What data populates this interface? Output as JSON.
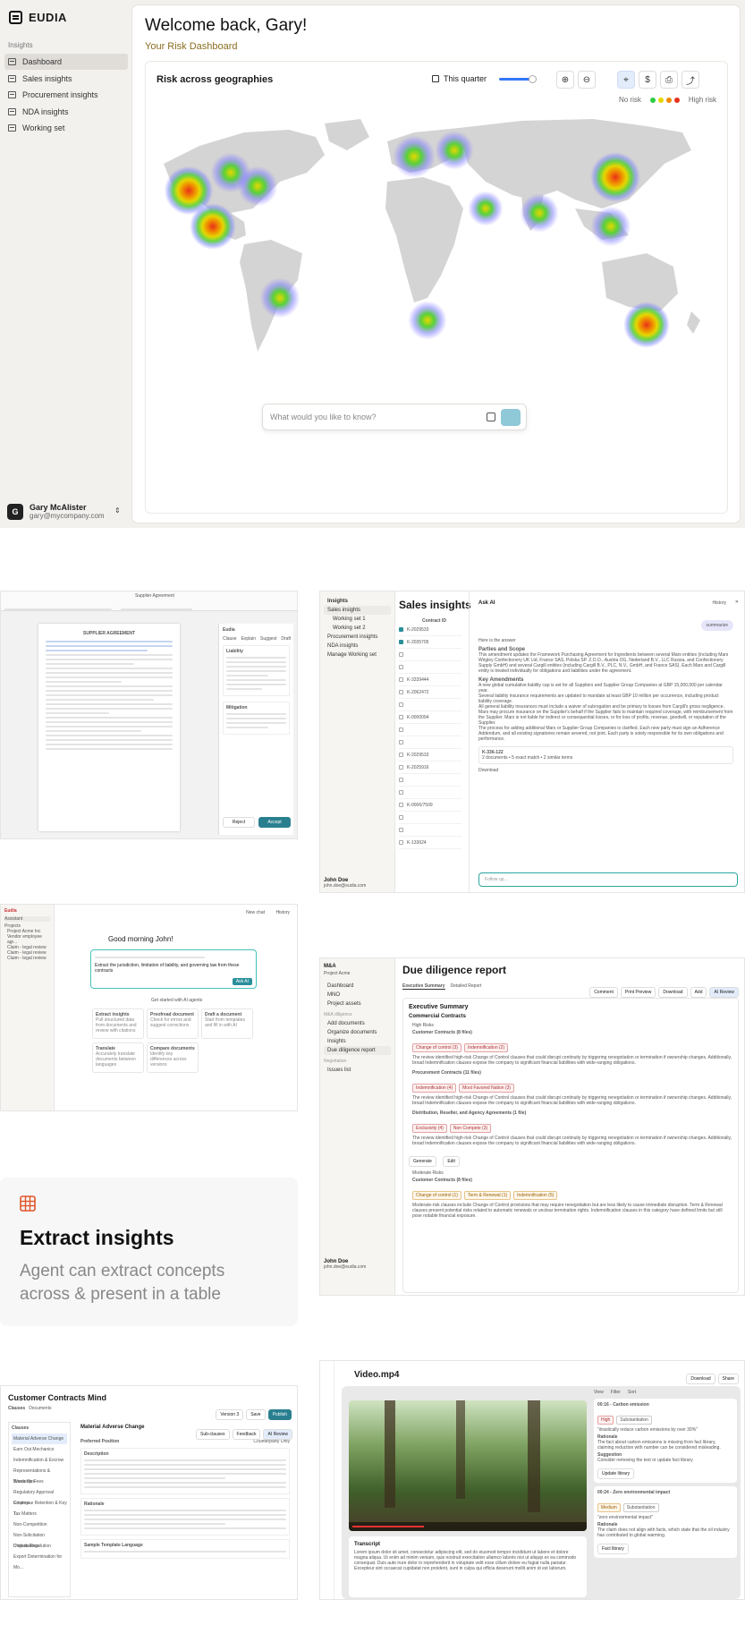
{
  "app": {
    "brand": "EUDIA"
  },
  "sidebar": {
    "section": "Insights",
    "items": [
      {
        "label": "Dashboard",
        "active": true
      },
      {
        "label": "Sales insights"
      },
      {
        "label": "Procurement insights"
      },
      {
        "label": "NDA insights"
      },
      {
        "label": "Working set"
      }
    ],
    "user": {
      "initial": "G",
      "name": "Gary McAlister",
      "email": "gary@mycompany.com"
    }
  },
  "dashboard": {
    "welcome": "Welcome back, Gary!",
    "subtitle": "Your Risk Dashboard",
    "map_title": "Risk across geographies",
    "period": "This quarter",
    "period_slider_level": 1.0,
    "legend": {
      "low": "No risk",
      "high": "High risk",
      "colors": [
        "#2ecc40",
        "#e5d700",
        "#f08a00",
        "#e8321b"
      ]
    },
    "ask_placeholder": "What would you like to know?",
    "hotspots": [
      {
        "region": "western-usa",
        "level": 0.95
      },
      {
        "region": "central-usa",
        "level": 0.6
      },
      {
        "region": "eastern-usa",
        "level": 0.6
      },
      {
        "region": "mexico",
        "level": 0.85
      },
      {
        "region": "brazil",
        "level": 0.6
      },
      {
        "region": "western-europe",
        "level": 0.7
      },
      {
        "region": "eastern-europe",
        "level": 0.55
      },
      {
        "region": "middle-east",
        "level": 0.4
      },
      {
        "region": "southern-africa",
        "level": 0.55
      },
      {
        "region": "india",
        "level": 0.55
      },
      {
        "region": "china",
        "level": 1.0
      },
      {
        "region": "southeast-asia",
        "level": 0.6
      },
      {
        "region": "australia",
        "level": 0.85
      }
    ]
  },
  "word_addin": {
    "title": "Supplier Agreement",
    "doc_heading": "SUPPLIER AGREEMENT",
    "pane_title": "Eudia",
    "pane_tabs": [
      "Clause",
      "Explain",
      "Suggest",
      "Draft"
    ],
    "liability": "Liability",
    "mitigation": "Mitigation",
    "buttons": [
      "Reject",
      "Accept"
    ]
  },
  "sales": {
    "title": "Sales insights",
    "ask_ai": "Ask AI",
    "history": "History",
    "summarize": "summarize",
    "intro": "Here is the answer",
    "parties_heading": "Parties and Scope",
    "parties_text": "This amendment updates the Framework Purchasing Agreement for Ingredients between several Mars entities (including Mars Wrigley Confectionery UK Ltd, France SAS, Polska SP. Z.O.O., Austria OG, Nederland B.V., LLC Russia, and Confectionery Supply GmbH) and several Cargill entities (including Cargill B.V., PLC, N.V., GmbH, and France SAS). Each Mars and Cargill entity is treated individually for obligations and liabilities under the agreement.",
    "amend_heading": "Key Amendments",
    "amendments": [
      "A new global cumulative liability cap is set for all Suppliers and Supplier Group Companies at GBP 15,000,000 per calendar year.",
      "Several liability insurance requirements are updated to mandate at least GBP 10 million per occurrence, including product liability coverage.",
      "All general liability insurances must include a waiver of subrogation and be primary to losses from Cargill's gross negligence. Mars may procure insurance on the Supplier's behalf if the Supplier fails to maintain required coverage, with reimbursement from the Supplier. Mars is not liable for indirect or consequential losses, or for loss of profits, revenue, goodwill, or reputation of the Supplier.",
      "The process for adding additional Mars or Supplier Group Companies is clarified. Each new party must sign an Adherence Addendum, and all existing signatories remain severed, not joint. Each party is solely responsible for its own obligations and performance."
    ],
    "ref": "K-336-122",
    "ref_sub": "2 documents • 5 exact match • 2 similar terms",
    "download": "Download",
    "follow_up": "Follow up...",
    "contract_header": "Contract ID",
    "contracts": [
      "K-2029533",
      "K-2035705",
      "",
      "",
      "K-3339444",
      "K-2062472",
      "",
      "K-0000094",
      "",
      "",
      "K-2029533",
      "K-2025916",
      "",
      "",
      "K-0006/7509",
      "",
      "",
      "K-133624"
    ],
    "side_items": [
      "Insights",
      "Sales insights",
      "Working set 1",
      "Working set 2",
      "Procurement insights",
      "NDA insights",
      "Manage Working set"
    ],
    "user": {
      "name": "John Doe",
      "email": "john.doe@eudia.com"
    }
  },
  "home": {
    "greeting": "Good morning John!",
    "new_chat": "New chat",
    "history": "History",
    "prompt": "Extract the jurisdiction, limitation of liability, and governing law from these contracts",
    "ask": "Ask AI",
    "get_started": "Get started with AI agents",
    "cards": [
      {
        "title": "Extract insights",
        "text": "Pull structured data from documents and review with citations"
      },
      {
        "title": "Proofread document",
        "text": "Check for errors and suggest corrections"
      },
      {
        "title": "Draft a document",
        "text": "Start from templates and fill in with AI"
      },
      {
        "title": "Translate",
        "text": "Accurately translate documents between languages"
      },
      {
        "title": "Compare documents",
        "text": "Identify key differences across versions"
      }
    ],
    "side_items": [
      "Eudia",
      "Assistant",
      "Projects",
      "Project Acme Inc",
      "Vendor employee agr...",
      "Claim - legal review",
      "Claim - legal review",
      "Claim - legal review"
    ]
  },
  "dd": {
    "side_title": "M&A",
    "project": "Project Acme",
    "side_items": [
      "Dashboard",
      "MNO",
      "Project assets",
      "Add documents",
      "Organize documents",
      "Insights",
      "Due diligence report",
      "Issues list"
    ],
    "side_sections": [
      "M&A diligence",
      "Negotiation"
    ],
    "title": "Due diligence report",
    "tabs": [
      "Executive Summary",
      "Detailed Report"
    ],
    "actions": [
      "Comment",
      "Print Preview",
      "Download",
      "Add",
      "AI Review"
    ],
    "exec_summary": "Executive Summary",
    "commercial": "Commercial Contracts",
    "high_risks": "High Risks",
    "blocks": [
      {
        "title": "Customer Contracts (8 files)",
        "tags": [
          "Change of control (3)",
          "Indemnification (2)"
        ],
        "text": "The review identified high-risk Change of Control clauses that could disrupt continuity by triggering renegotiation or termination if ownership changes. Additionally, broad Indemnification clauses expose the company to significant financial liabilities with wide-ranging obligations."
      },
      {
        "title": "Procurement Contracts (11 files)",
        "tags": [
          "Indemnification (4)",
          "Most Favored Nation (3)"
        ],
        "text": "The review identified high-risk Change of Control clauses that could disrupt continuity by triggering renegotiation or termination if ownership changes. Additionally, broad Indemnification clauses expose the company to significant financial liabilities with wide-ranging obligations."
      },
      {
        "title": "Distribution, Reseller, and Agency Agreements (1 file)",
        "tags": [
          "Exclusivity (4)",
          "Non Compete (3)"
        ],
        "text": "The review identified high-risk Change of Control clauses that could disrupt continuity by triggering renegotiation or termination if ownership changes. Additionally, broad Indemnification clauses expose the company to significant financial liabilities with wide-ranging obligations."
      }
    ],
    "generate": "Generate",
    "edit": "Edit",
    "moderate": "Moderate Risks",
    "mod_block": {
      "title": "Customer Contracts (8 files)",
      "tags": [
        "Change of control (1)",
        "Term & Renewal (1)",
        "Indemnification (5)"
      ],
      "text": "Moderate-risk clauses include Change of Control provisions that may require renegotiation but are less likely to cause immediate disruption. Term & Renewal clauses present potential risks related to automatic renewals or unclear termination rights. Indemnification clauses in this category have defined limits but still pose notable financial exposure."
    },
    "user": {
      "name": "John Doe",
      "email": "john.doe@eudia.com"
    }
  },
  "feature": {
    "title": "Extract insights",
    "text": "Agent can extract concepts across & present in a table"
  },
  "playbook": {
    "title": "Customer Contracts Mind",
    "tabs": [
      "Clauses",
      "Documents"
    ],
    "version": "Version 3",
    "save": "Save",
    "publish": "Publish",
    "clauses_heading": "Clauses",
    "clauses": [
      "Material Adverse Change",
      "Earn Out Mechanics",
      "Indemnification & Escrow",
      "Representations & Warranties",
      "Break-Up Fees",
      "Regulatory Approval Covena...",
      "Employee Retention & Key T...",
      "Tax Matters",
      "Non-Competition",
      "Non-Solicitation Undertakings",
      "Dispute Resolution",
      "Export Determination for Mo..."
    ],
    "clause_title": "Material Adverse Change",
    "clause_actions": [
      "Sub-clauses",
      "Feedback",
      "AI Review"
    ],
    "preferred": "Preferred Position",
    "party": "Counterparty Only",
    "sections": [
      "Description",
      "Rationale",
      "Sample Template Language"
    ]
  },
  "video": {
    "title": "Video.mp4",
    "actions": [
      "Download",
      "Share"
    ],
    "view": "View",
    "filter": "Filter",
    "sort": "Sort",
    "transcript": "Transcript",
    "transcript_text": "Lorem ipsum dolor sit amet, consectetur adipiscing elit, sed do eiusmod tempor incididunt ut labore et dolore magna aliqua. Ut enim ad minim veniam, quis nostrud exercitation ullamco laboris nisi ut aliquip ex ea commodo consequat. Duis aute irure dolor in reprehenderit in voluptate velit esse cillum dolore eu fugiat nulla pariatur. Excepteur sint occaecat cupidatat non proident, sunt in culpa qui officia deserunt mollit anim id est laborum.",
    "items": [
      {
        "time": "00:16 - Carbon emission",
        "badges": [
          "High",
          "Substantiation"
        ],
        "quote": "\"drastically reduce carbon emissions by over 30%\"",
        "rationale_h": "Rationale",
        "rationale": "The fact about carbon emissions is missing from fact library, claiming reduction with number can be considered misleading.",
        "suggestion_h": "Suggestion",
        "suggestion": "Consider removing the text or update fact library",
        "button": "Update library"
      },
      {
        "time": "00:24 - Zero environmental impact",
        "badges": [
          "Medium",
          "Substantiation"
        ],
        "quote": "\"zero environmental impact\"",
        "rationale_h": "Rationale",
        "rationale": "The claim does not align with facts, which state that the oil industry has contributed to global warming.",
        "button": "Fact library"
      }
    ]
  }
}
